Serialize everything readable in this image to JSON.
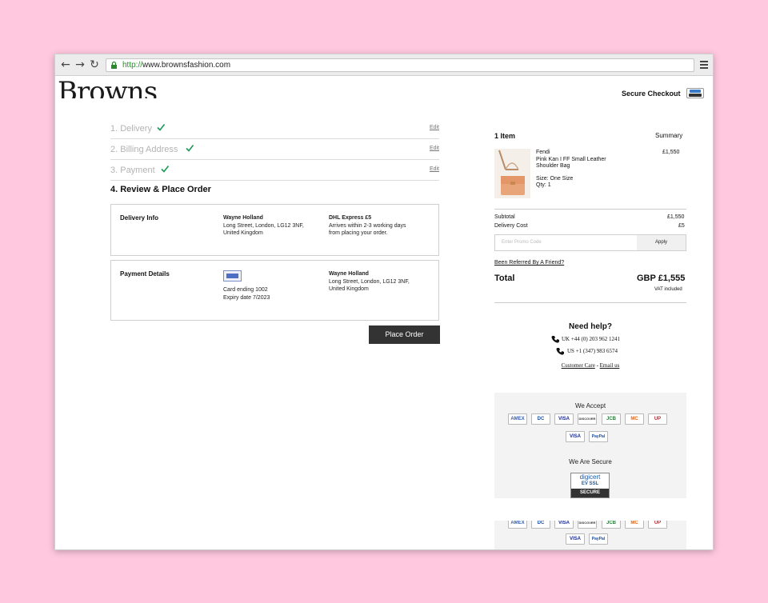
{
  "browser": {
    "url_protocol": "http://",
    "url_host": "www.brownsfashion.com"
  },
  "header": {
    "logo": "Browns",
    "secure_checkout": "Secure Checkout"
  },
  "steps": [
    {
      "label": "1. Delivery",
      "edit": "Edit"
    },
    {
      "label": "2. Billing Address",
      "edit": "Edit"
    },
    {
      "label": "3. Payment",
      "edit": "Edit"
    }
  ],
  "active_step": "4. Review & Place Order",
  "delivery_info": {
    "title": "Delivery Info",
    "name": "Wayne Holland",
    "address1": "Long Street, London, LG12 3NF,",
    "address2": "United Kingdom",
    "method": "DHL Express £5",
    "arrival1": "Arrives within 2-3 working days",
    "arrival2": "from placing your order."
  },
  "payment_details": {
    "title": "Payment Details",
    "card_line": "Card ending 1002",
    "expiry_line": "Expiry date 7/2023",
    "name": "Wayne Holland",
    "address1": "Long Street, London, LG12 3NF,",
    "address2": "United Kingdom"
  },
  "place_order": "Place Order",
  "summary": {
    "item_count": "1 Item",
    "heading": "Summary",
    "brand": "Fendi",
    "product1": "Pink Kan I FF Small Leather",
    "product2": "Shoulder Bag",
    "size": "Size: One Size",
    "qty": "Qty: 1",
    "price": "£1,550",
    "subtotal_label": "Subtotal",
    "subtotal_value": "£1,550",
    "delivery_label": "Delivery Cost",
    "delivery_value": "£5",
    "promo_placeholder": "Enter Promo Code",
    "apply": "Apply",
    "referred": "Been Referred By A Friend?",
    "total_label": "Total",
    "total_value": "GBP £1,555",
    "vat": "VAT included"
  },
  "help": {
    "title": "Need help?",
    "uk": "UK +44 (0) 203 962 1241",
    "us": "US +1 (347) 983 6574",
    "care": "Customer Care",
    "sep": " - ",
    "email": "Email us"
  },
  "payments": {
    "accept_title": "We Accept",
    "secure_title": "We Are Secure",
    "cards_row1": [
      "AMEX",
      "DC",
      "VISA",
      "DISCOVER",
      "JCB",
      "MC",
      "UP"
    ],
    "cards_row2": [
      "VISA",
      "PayPal"
    ],
    "digicert_top": "digicert",
    "digicert_ev": "EV SSL",
    "digicert_bar": "SECURE"
  },
  "colors": {
    "check": "#1a9a5a",
    "button": "#333333",
    "page_bg": "#ffc8df"
  }
}
